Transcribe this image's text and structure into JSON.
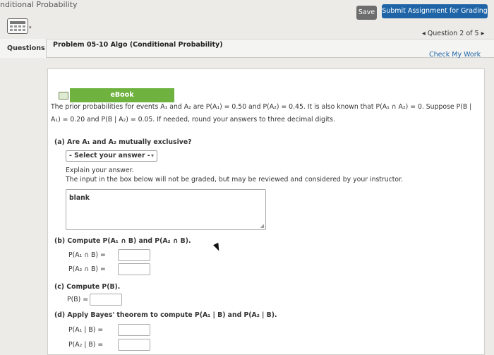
{
  "app": {
    "title": "nditional Probability"
  },
  "toolbar": {
    "save_label": "Save",
    "submit_label": "Submit Assignment for Grading"
  },
  "nav": {
    "question_position": "◂ Question 2 of 5 ▸",
    "check_work": "Check My Work"
  },
  "tabs": {
    "questions": "Questions"
  },
  "problem": {
    "title": "Problem 05-10 Algo (Conditional Probability)",
    "ebook": "eBook",
    "intro_line1": "The prior probabilities for events A₁ and A₂ are P(A₁) = 0.50 and P(A₂) = 0.45. It is also known that P(A₁ ∩ A₂) = 0. Suppose P(B |",
    "intro_line2": "A₁) = 0.20 and P(B | A₂) = 0.05. If needed, round your answers to three decimal digits."
  },
  "part_a": {
    "question": "(a) Are A₁ and A₂ mutually exclusive?",
    "select_value": "- Select your answer -",
    "explain": "Explain your answer.",
    "note": "The input in the box below will not be graded, but may be reviewed and considered by your instructor.",
    "textarea_value": "blank"
  },
  "part_b": {
    "question": "(b) Compute P(A₁ ∩ B) and P(A₂ ∩ B).",
    "label1": "P(A₁ ∩ B) =",
    "label2": "P(A₂ ∩ B) ="
  },
  "part_c": {
    "question": "(c) Compute P(B).",
    "label1": "P(B) ="
  },
  "part_d": {
    "question": "(d) Apply Bayes' theorem to compute P(A₁ | B) and P(A₂ | B).",
    "label1": "P(A₁ | B) =",
    "label2": "P(A₂ | B) ="
  },
  "icons": {
    "calculator": "calculator-icon",
    "ebook": "book-icon"
  },
  "colors": {
    "submit": "#1e64a6",
    "ebook": "#6fb23f",
    "save": "#6d6d6d"
  }
}
